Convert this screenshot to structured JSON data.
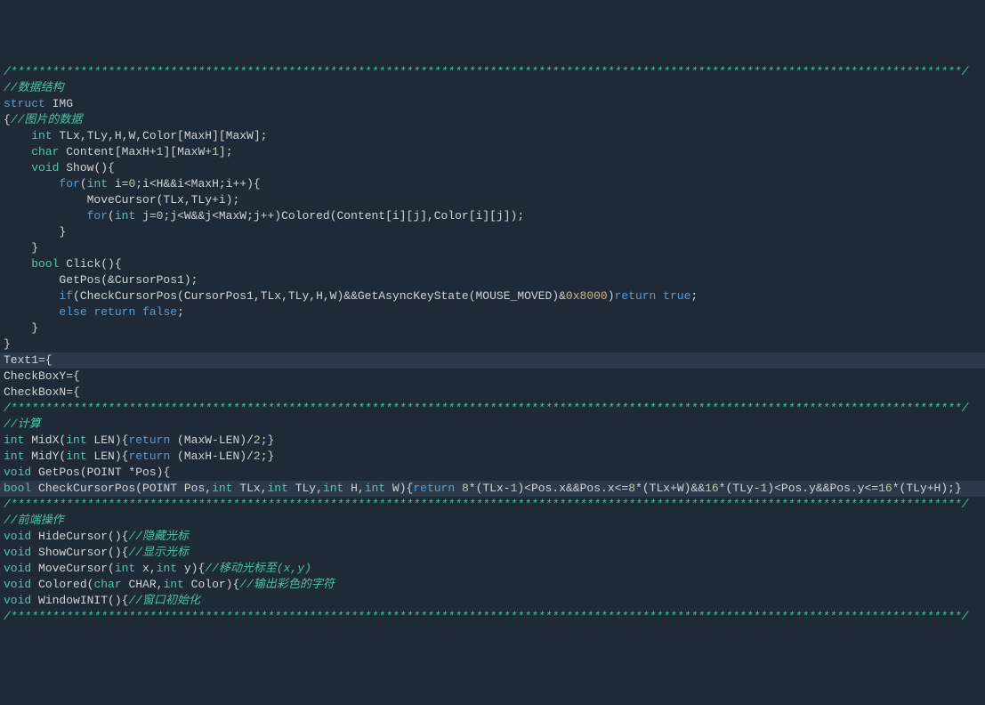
{
  "editor": {
    "lines": [
      {
        "segs": [
          {
            "t": "/*****************************************************************************************************************************************/",
            "c": "comment"
          }
        ]
      },
      {
        "segs": [
          {
            "t": "//数据结构",
            "c": "comment"
          }
        ]
      },
      {
        "segs": [
          {
            "t": "struct",
            "c": "keyword"
          },
          {
            "t": " IMG",
            "c": "ident"
          }
        ]
      },
      {
        "segs": [
          {
            "t": "{",
            "c": "paren"
          },
          {
            "t": "//图片的数据",
            "c": "comment"
          }
        ]
      },
      {
        "segs": [
          {
            "t": "    ",
            "c": "op"
          },
          {
            "t": "int",
            "c": "type"
          },
          {
            "t": " TLx,TLy,H,W,Color[MaxH][MaxW];",
            "c": "ident"
          }
        ]
      },
      {
        "segs": [
          {
            "t": "    ",
            "c": "op"
          },
          {
            "t": "char",
            "c": "type"
          },
          {
            "t": " Content[MaxH+",
            "c": "ident"
          },
          {
            "t": "1",
            "c": "number"
          },
          {
            "t": "][MaxW+",
            "c": "ident"
          },
          {
            "t": "1",
            "c": "number"
          },
          {
            "t": "];",
            "c": "ident"
          }
        ]
      },
      {
        "segs": [
          {
            "t": "    ",
            "c": "op"
          },
          {
            "t": "void",
            "c": "type"
          },
          {
            "t": " Show(){",
            "c": "ident"
          }
        ]
      },
      {
        "segs": [
          {
            "t": "        ",
            "c": "op"
          },
          {
            "t": "for",
            "c": "keyword"
          },
          {
            "t": "(",
            "c": "paren"
          },
          {
            "t": "int",
            "c": "type"
          },
          {
            "t": " i=",
            "c": "ident"
          },
          {
            "t": "0",
            "c": "number"
          },
          {
            "t": ";i<H&&i<MaxH;i++){",
            "c": "ident"
          }
        ]
      },
      {
        "segs": [
          {
            "t": "            MoveCursor(TLx,TLy+i);",
            "c": "ident"
          }
        ]
      },
      {
        "segs": [
          {
            "t": "            ",
            "c": "op"
          },
          {
            "t": "for",
            "c": "keyword"
          },
          {
            "t": "(",
            "c": "paren"
          },
          {
            "t": "int",
            "c": "type"
          },
          {
            "t": " j=",
            "c": "ident"
          },
          {
            "t": "0",
            "c": "number"
          },
          {
            "t": ";j<W&&j<MaxW;j++)Colored(Content[i][j],Color[i][j]);",
            "c": "ident"
          }
        ]
      },
      {
        "segs": [
          {
            "t": "        }",
            "c": "ident"
          }
        ]
      },
      {
        "segs": [
          {
            "t": "    }",
            "c": "ident"
          }
        ]
      },
      {
        "segs": [
          {
            "t": "    ",
            "c": "op"
          },
          {
            "t": "bool",
            "c": "type"
          },
          {
            "t": " Click(){",
            "c": "ident"
          }
        ]
      },
      {
        "segs": [
          {
            "t": "        GetPos(&CursorPos1);",
            "c": "ident"
          }
        ]
      },
      {
        "segs": [
          {
            "t": "        ",
            "c": "op"
          },
          {
            "t": "if",
            "c": "keyword"
          },
          {
            "t": "(CheckCursorPos(CursorPos1,TLx,TLy,H,W)&&GetAsyncKeyState(MOUSE_MOVED)&",
            "c": "ident"
          },
          {
            "t": "0x8000",
            "c": "hex"
          },
          {
            "t": ")",
            "c": "paren"
          },
          {
            "t": "return",
            "c": "keyword"
          },
          {
            "t": " ",
            "c": "op"
          },
          {
            "t": "true",
            "c": "keyword"
          },
          {
            "t": ";",
            "c": "ident"
          }
        ]
      },
      {
        "segs": [
          {
            "t": "        ",
            "c": "op"
          },
          {
            "t": "else",
            "c": "keyword"
          },
          {
            "t": " ",
            "c": "op"
          },
          {
            "t": "return",
            "c": "keyword"
          },
          {
            "t": " ",
            "c": "op"
          },
          {
            "t": "false",
            "c": "keyword"
          },
          {
            "t": ";",
            "c": "ident"
          }
        ]
      },
      {
        "segs": [
          {
            "t": "    }",
            "c": "ident"
          }
        ]
      },
      {
        "segs": [
          {
            "t": "}",
            "c": "ident"
          }
        ]
      },
      {
        "segs": [
          {
            "t": "Text1={",
            "c": "ident"
          }
        ],
        "hl": true
      },
      {
        "segs": [
          {
            "t": "CheckBoxY={",
            "c": "ident"
          }
        ]
      },
      {
        "segs": [
          {
            "t": "CheckBoxN={",
            "c": "ident"
          }
        ]
      },
      {
        "segs": [
          {
            "t": "/*****************************************************************************************************************************************/",
            "c": "comment"
          }
        ]
      },
      {
        "segs": [
          {
            "t": "//计算",
            "c": "comment"
          }
        ]
      },
      {
        "segs": [
          {
            "t": "int",
            "c": "type"
          },
          {
            "t": " MidX(",
            "c": "ident"
          },
          {
            "t": "int",
            "c": "type"
          },
          {
            "t": " LEN){",
            "c": "ident"
          },
          {
            "t": "return",
            "c": "keyword"
          },
          {
            "t": " (MaxW-LEN)/",
            "c": "ident"
          },
          {
            "t": "2",
            "c": "number"
          },
          {
            "t": ";}",
            "c": "ident"
          }
        ]
      },
      {
        "segs": [
          {
            "t": "int",
            "c": "type"
          },
          {
            "t": " MidY(",
            "c": "ident"
          },
          {
            "t": "int",
            "c": "type"
          },
          {
            "t": " LEN){",
            "c": "ident"
          },
          {
            "t": "return",
            "c": "keyword"
          },
          {
            "t": " (MaxH-LEN)/",
            "c": "ident"
          },
          {
            "t": "2",
            "c": "number"
          },
          {
            "t": ";}",
            "c": "ident"
          }
        ]
      },
      {
        "segs": [
          {
            "t": "void",
            "c": "type"
          },
          {
            "t": " GetPos(POINT *Pos){",
            "c": "ident"
          }
        ]
      },
      {
        "segs": [
          {
            "t": "bool",
            "c": "type"
          },
          {
            "t": " CheckCursorPos(POINT Pos,",
            "c": "ident"
          },
          {
            "t": "int",
            "c": "type"
          },
          {
            "t": " TLx,",
            "c": "ident"
          },
          {
            "t": "int",
            "c": "type"
          },
          {
            "t": " TLy,",
            "c": "ident"
          },
          {
            "t": "int",
            "c": "type"
          },
          {
            "t": " H,",
            "c": "ident"
          },
          {
            "t": "int",
            "c": "type"
          },
          {
            "t": " W){",
            "c": "ident"
          },
          {
            "t": "return",
            "c": "keyword"
          },
          {
            "t": " ",
            "c": "op"
          },
          {
            "t": "8",
            "c": "number"
          },
          {
            "t": "*(TLx-",
            "c": "ident"
          },
          {
            "t": "1",
            "c": "number"
          },
          {
            "t": ")<Pos.x&&Pos.x<=",
            "c": "ident"
          },
          {
            "t": "8",
            "c": "number"
          },
          {
            "t": "*(TLx+W)&&",
            "c": "ident"
          },
          {
            "t": "16",
            "c": "number"
          },
          {
            "t": "*(TLy-",
            "c": "ident"
          },
          {
            "t": "1",
            "c": "number"
          },
          {
            "t": ")<Pos.y&&Pos.y<=",
            "c": "ident"
          },
          {
            "t": "16",
            "c": "number"
          },
          {
            "t": "*(TLy+H);}",
            "c": "ident"
          }
        ],
        "hl": true
      },
      {
        "segs": [
          {
            "t": "/*****************************************************************************************************************************************/",
            "c": "comment"
          }
        ]
      },
      {
        "segs": [
          {
            "t": "//前端操作",
            "c": "comment"
          }
        ]
      },
      {
        "segs": [
          {
            "t": "void",
            "c": "type"
          },
          {
            "t": " HideCursor(){",
            "c": "ident"
          },
          {
            "t": "//隐藏光标",
            "c": "comment"
          }
        ]
      },
      {
        "segs": [
          {
            "t": "void",
            "c": "type"
          },
          {
            "t": " ShowCursor(){",
            "c": "ident"
          },
          {
            "t": "//显示光标",
            "c": "comment"
          }
        ]
      },
      {
        "segs": [
          {
            "t": "void",
            "c": "type"
          },
          {
            "t": " MoveCursor(",
            "c": "ident"
          },
          {
            "t": "int",
            "c": "type"
          },
          {
            "t": " x,",
            "c": "ident"
          },
          {
            "t": "int",
            "c": "type"
          },
          {
            "t": " y){",
            "c": "ident"
          },
          {
            "t": "//移动光标至(x,y)",
            "c": "comment"
          }
        ]
      },
      {
        "segs": [
          {
            "t": "void",
            "c": "type"
          },
          {
            "t": " Colored(",
            "c": "ident"
          },
          {
            "t": "char",
            "c": "type"
          },
          {
            "t": " CHAR,",
            "c": "ident"
          },
          {
            "t": "int",
            "c": "type"
          },
          {
            "t": " Color){",
            "c": "ident"
          },
          {
            "t": "//输出彩色的字符",
            "c": "comment"
          }
        ]
      },
      {
        "segs": [
          {
            "t": "void",
            "c": "type"
          },
          {
            "t": " WindowINIT(){",
            "c": "ident"
          },
          {
            "t": "//窗口初始化",
            "c": "comment"
          }
        ]
      },
      {
        "segs": [
          {
            "t": "/*****************************************************************************************************************************************/",
            "c": "comment"
          }
        ]
      }
    ]
  }
}
